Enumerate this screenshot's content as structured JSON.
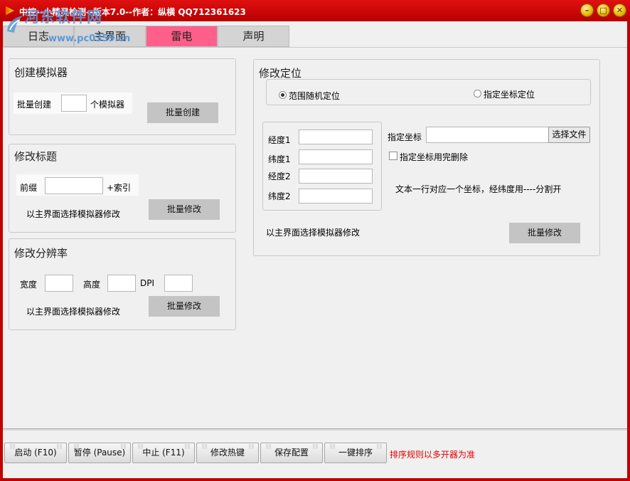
{
  "window": {
    "title": "中控--小精灵检测--版本7.0--作者：纵横 QQ712361623",
    "watermark": "河东软件网",
    "watermark_url": "www.pc0359.cn"
  },
  "tabs": [
    {
      "label": "日志"
    },
    {
      "label": "主界面"
    },
    {
      "label": "雷电",
      "active": true
    },
    {
      "label": "声明"
    }
  ],
  "create_panel": {
    "title": "创建模拟器",
    "batch_label": "批量创建",
    "count_value": "",
    "unit_label": "个模拟器",
    "button": "批量创建"
  },
  "title_panel": {
    "title": "修改标题",
    "prefix_label": "前缀",
    "prefix_value": "",
    "index_label": "+索引",
    "hint": "以主界面选择模拟器修改",
    "button": "批量修改"
  },
  "resolution_panel": {
    "title": "修改分辨率",
    "width_label": "宽度",
    "height_label": "高度",
    "dpi_label": "DPI",
    "width_value": "",
    "height_value": "",
    "dpi_value": "",
    "hint": "以主界面选择模拟器修改",
    "button": "批量修改"
  },
  "location_panel": {
    "title": "修改定位",
    "radio_random": "范围随机定位",
    "radio_fixed": "指定坐标定位",
    "selected": "范围随机定位",
    "lng1_label": "经度1",
    "lat1_label": "纬度1",
    "lng2_label": "经度2",
    "lat2_label": "纬度2",
    "lng1_value": "",
    "lat1_value": "",
    "lng2_value": "",
    "lat2_value": "",
    "coord_label": "指定坐标",
    "coord_value": "",
    "choose_file": "选择文件",
    "delete_after_label": "指定坐标用完删除",
    "delete_after_checked": false,
    "note": "文本一行对应一个坐标，经纬度用----分割开",
    "hint": "以主界面选择模拟器修改",
    "button": "批量修改"
  },
  "footer": {
    "buttons": [
      "启动 (F10)",
      "暂停 (Pause)",
      "中止 (F11)",
      "修改热键",
      "保存配置",
      "一键排序"
    ],
    "rule_note": "排序规则以多开器为准"
  },
  "colors": {
    "titlebar": "#c00000",
    "active_tab": "#ff5f8a",
    "note_red": "#e00000",
    "watermark": "#5a9ad8"
  },
  "icons": [
    "app-icon",
    "watermark-logo-icon",
    "minimize-icon",
    "maximize-icon",
    "close-icon"
  ]
}
